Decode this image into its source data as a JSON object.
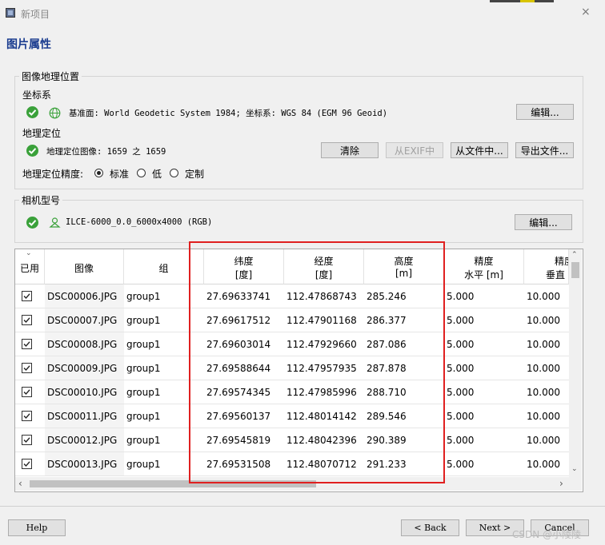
{
  "window": {
    "title": "新项目",
    "close_glyph": "×"
  },
  "heading": "图片属性",
  "geo": {
    "group_label": "图像地理位置",
    "crs_label": "坐标系",
    "crs_text": "基准面: World Geodetic System 1984; 坐标系: WGS 84 (EGM 96 Geoid)",
    "edit_label": "编辑...",
    "georef_label": "地理定位",
    "georef_text": "地理定位图像: 1659 之 1659",
    "clear_label": "清除",
    "from_exif_label": "从EXIF中",
    "from_file_label": "从文件中...",
    "export_label": "导出文件...",
    "accuracy_label": "地理定位精度:",
    "accuracy_options": [
      "标准",
      "低",
      "定制"
    ],
    "accuracy_selected": "标准"
  },
  "camera": {
    "group_label": "相机型号",
    "model_text": "ILCE-6000_0.0_6000x4000 (RGB)",
    "edit_label": "编辑..."
  },
  "table": {
    "headers": {
      "enabled": "已用",
      "image": "图像",
      "group": "组",
      "lat": [
        "纬度",
        "[度]"
      ],
      "lon": [
        "经度",
        "[度]"
      ],
      "alt": [
        "高度",
        "[m]"
      ],
      "acc_h": [
        "精度",
        "水平 [m]"
      ],
      "acc_v": [
        "精度",
        "垂直"
      ]
    },
    "rows": [
      {
        "image": "DSC00006.JPG",
        "group": "group1",
        "lat": "27.69633741",
        "lon": "112.47868743",
        "alt": "285.246",
        "acc_h": "5.000",
        "acc_v": "10.000"
      },
      {
        "image": "DSC00007.JPG",
        "group": "group1",
        "lat": "27.69617512",
        "lon": "112.47901168",
        "alt": "286.377",
        "acc_h": "5.000",
        "acc_v": "10.000"
      },
      {
        "image": "DSC00008.JPG",
        "group": "group1",
        "lat": "27.69603014",
        "lon": "112.47929660",
        "alt": "287.086",
        "acc_h": "5.000",
        "acc_v": "10.000"
      },
      {
        "image": "DSC00009.JPG",
        "group": "group1",
        "lat": "27.69588644",
        "lon": "112.47957935",
        "alt": "287.878",
        "acc_h": "5.000",
        "acc_v": "10.000"
      },
      {
        "image": "DSC00010.JPG",
        "group": "group1",
        "lat": "27.69574345",
        "lon": "112.47985996",
        "alt": "288.710",
        "acc_h": "5.000",
        "acc_v": "10.000"
      },
      {
        "image": "DSC00011.JPG",
        "group": "group1",
        "lat": "27.69560137",
        "lon": "112.48014142",
        "alt": "289.546",
        "acc_h": "5.000",
        "acc_v": "10.000"
      },
      {
        "image": "DSC00012.JPG",
        "group": "group1",
        "lat": "27.69545819",
        "lon": "112.48042396",
        "alt": "290.389",
        "acc_h": "5.000",
        "acc_v": "10.000"
      },
      {
        "image": "DSC00013.JPG",
        "group": "group1",
        "lat": "27.69531508",
        "lon": "112.48070712",
        "alt": "291.233",
        "acc_h": "5.000",
        "acc_v": "10.000"
      }
    ]
  },
  "footer": {
    "help_label": "Help",
    "back_label": "< Back",
    "next_label": "Next >",
    "cancel_label": "Cancel",
    "watermark": "CSDN @小陵陵"
  },
  "colors": {
    "ok_green": "#3aa13a",
    "heading_blue": "#1a3c8f",
    "highlight_red": "#e02020"
  }
}
